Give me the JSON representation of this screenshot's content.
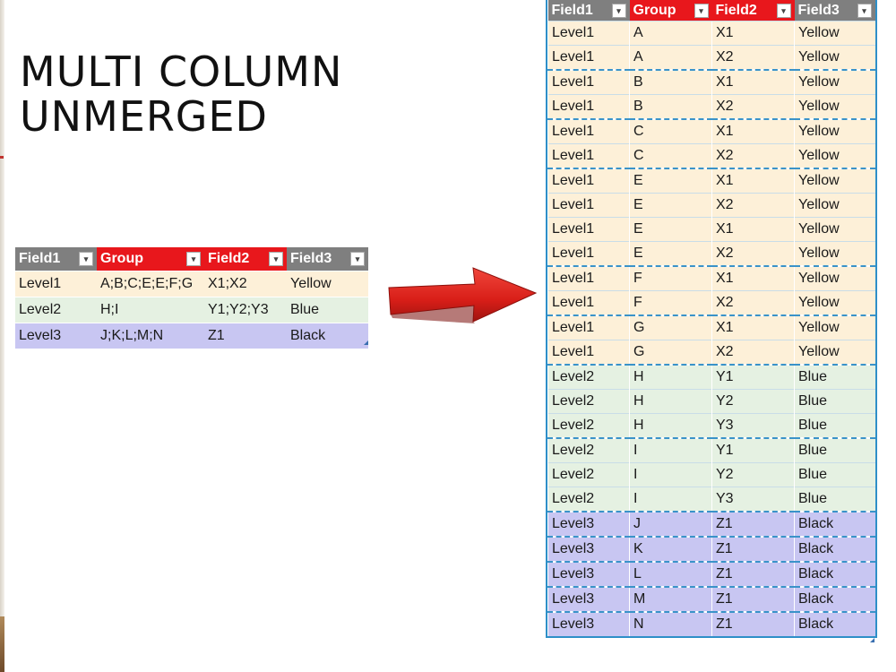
{
  "slide": {
    "title_line1": "MULTI COLUMN",
    "title_line2": "UNMERGED"
  },
  "source_table": {
    "headers": [
      "Field1",
      "Group",
      "Field2",
      "Field3"
    ],
    "header_colors": [
      "#7f7f7f",
      "#e8171c",
      "#e8171c",
      "#7f7f7f"
    ],
    "rows": [
      [
        "Level1",
        "A;B;C;E;E;F;G",
        "X1;X2",
        "Yellow"
      ],
      [
        "Level2",
        "H;I",
        "Y1;Y2;Y3",
        "Blue"
      ],
      [
        "Level3",
        "J;K;L;M;N",
        "Z1",
        "Black"
      ]
    ]
  },
  "result_table": {
    "headers": [
      "Field1",
      "Group",
      "Field2",
      "Field3"
    ],
    "header_colors": [
      "#7f7f7f",
      "#e8171c",
      "#e8171c",
      "#7f7f7f"
    ],
    "rows": [
      [
        "Level1",
        "A",
        "X1",
        "Yellow"
      ],
      [
        "Level1",
        "A",
        "X2",
        "Yellow"
      ],
      [
        "Level1",
        "B",
        "X1",
        "Yellow"
      ],
      [
        "Level1",
        "B",
        "X2",
        "Yellow"
      ],
      [
        "Level1",
        "C",
        "X1",
        "Yellow"
      ],
      [
        "Level1",
        "C",
        "X2",
        "Yellow"
      ],
      [
        "Level1",
        "E",
        "X1",
        "Yellow"
      ],
      [
        "Level1",
        "E",
        "X2",
        "Yellow"
      ],
      [
        "Level1",
        "E",
        "X1",
        "Yellow"
      ],
      [
        "Level1",
        "E",
        "X2",
        "Yellow"
      ],
      [
        "Level1",
        "F",
        "X1",
        "Yellow"
      ],
      [
        "Level1",
        "F",
        "X2",
        "Yellow"
      ],
      [
        "Level1",
        "G",
        "X1",
        "Yellow"
      ],
      [
        "Level1",
        "G",
        "X2",
        "Yellow"
      ],
      [
        "Level2",
        "H",
        "Y1",
        "Blue"
      ],
      [
        "Level2",
        "H",
        "Y2",
        "Blue"
      ],
      [
        "Level2",
        "H",
        "Y3",
        "Blue"
      ],
      [
        "Level2",
        "I",
        "Y1",
        "Blue"
      ],
      [
        "Level2",
        "I",
        "Y2",
        "Blue"
      ],
      [
        "Level2",
        "I",
        "Y3",
        "Blue"
      ],
      [
        "Level3",
        "J",
        "Z1",
        "Black"
      ],
      [
        "Level3",
        "K",
        "Z1",
        "Black"
      ],
      [
        "Level3",
        "L",
        "Z1",
        "Black"
      ],
      [
        "Level3",
        "M",
        "Z1",
        "Black"
      ],
      [
        "Level3",
        "N",
        "Z1",
        "Black"
      ]
    ]
  },
  "colors": {
    "level1_band": "#fdf0d8",
    "level2_band": "#e5f1e2",
    "level3_band": "#c8c6f2",
    "arrow": "#e3201b"
  },
  "icons": {
    "filter": "filter-dropdown-icon",
    "arrow": "right-arrow-icon"
  }
}
